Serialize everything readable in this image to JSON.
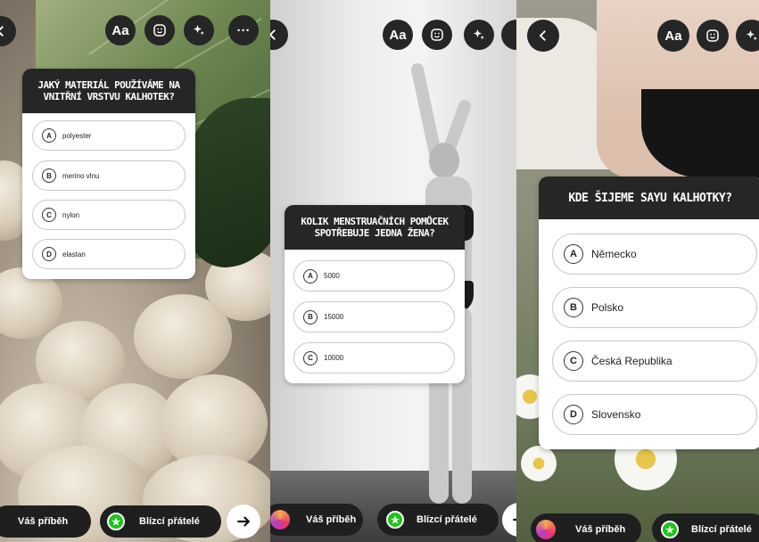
{
  "panels": [
    {
      "top_buttons": {
        "text_label": "Aa",
        "more_label": "···"
      },
      "quiz": {
        "question": "Jaký materiál používáme na vnitřní vrstvu kalhotek?",
        "options": [
          {
            "letter": "A",
            "text": "polyester"
          },
          {
            "letter": "B",
            "text": "merino vlnu"
          },
          {
            "letter": "C",
            "text": "nylon"
          },
          {
            "letter": "D",
            "text": "elastan"
          }
        ]
      },
      "bottom": {
        "your_story": "Váš příběh",
        "close_friends": "Blízcí přátelé"
      }
    },
    {
      "top_buttons": {
        "text_label": "Aa"
      },
      "quiz": {
        "question": "Kolik menstruačních pomůcek spotřebuje jedna žena?",
        "options": [
          {
            "letter": "A",
            "text": "5000"
          },
          {
            "letter": "B",
            "text": "15000"
          },
          {
            "letter": "C",
            "text": "10000"
          }
        ]
      },
      "bottom": {
        "your_story": "Váš příběh",
        "close_friends": "Blízcí přátelé"
      }
    },
    {
      "top_buttons": {
        "text_label": "Aa"
      },
      "quiz": {
        "question": "Kde šijeme Sayu kalhotky?",
        "options": [
          {
            "letter": "A",
            "text": "Německo"
          },
          {
            "letter": "B",
            "text": "Polsko"
          },
          {
            "letter": "C",
            "text": "Česká Republika"
          },
          {
            "letter": "D",
            "text": "Slovensko"
          }
        ]
      },
      "bottom": {
        "your_story": "Váš příběh",
        "close_friends": "Blízcí přátelé"
      }
    }
  ],
  "colors": {
    "button_bg": "#262626",
    "close_friends_green": "#1ec31a",
    "card_header": "#262626"
  },
  "icons": [
    "back-chevron-icon",
    "sticker-icon",
    "effects-sparkle-icon",
    "more-icon",
    "star-icon",
    "arrow-right-icon"
  ]
}
